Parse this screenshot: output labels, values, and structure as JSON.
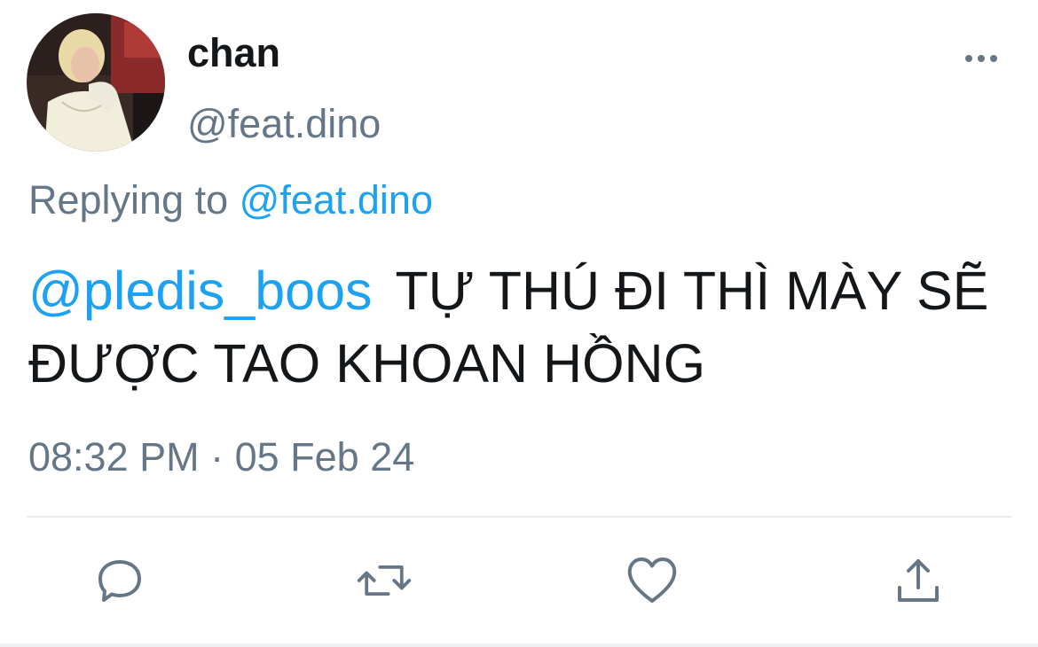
{
  "author": {
    "display_name": "chan",
    "handle": "@feat.dino",
    "avatar_icon": "profile-photo"
  },
  "reply": {
    "prefix": "Replying to",
    "target": "@feat.dino"
  },
  "tweet": {
    "mention": "@pledis_boos",
    "text": "TỰ THÚ ĐI THÌ MÀY SẼ ĐƯỢC TAO KHOAN HỒNG"
  },
  "timestamp": "08:32 PM · 05 Feb 24",
  "actions": [
    {
      "name": "reply",
      "icon": "speech-bubble-icon"
    },
    {
      "name": "retweet",
      "icon": "retweet-icon"
    },
    {
      "name": "like",
      "icon": "heart-icon"
    },
    {
      "name": "share",
      "icon": "share-icon"
    }
  ],
  "colors": {
    "link": "#1da1f2",
    "text": "#14171a",
    "secondary": "#657786",
    "icon": "#657786",
    "divider": "#e6ecf0"
  }
}
